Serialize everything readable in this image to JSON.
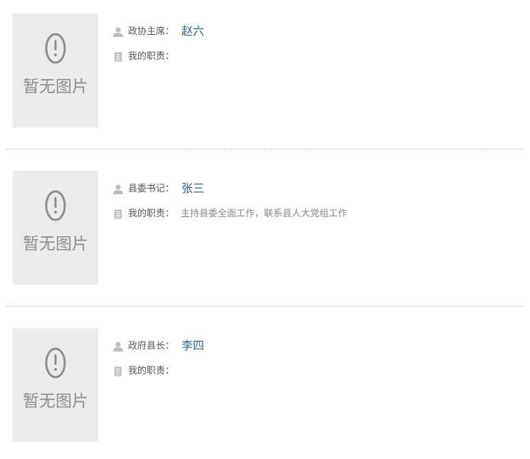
{
  "leaders": [
    {
      "photo_placeholder": "暂无图片",
      "title_label": "政协主席：",
      "name": "赵六",
      "duty_label": "我的职责：",
      "duty": ""
    },
    {
      "photo_placeholder": "暂无图片",
      "title_label": "县委书记：",
      "name": "张三",
      "duty_label": "我的职责：",
      "duty": "主持县委全面工作，联系县人大党组工作"
    },
    {
      "photo_placeholder": "暂无图片",
      "title_label": "政府县长：",
      "name": "李四",
      "duty_label": "我的职责：",
      "duty": ""
    }
  ],
  "icons": {
    "person": "user-icon",
    "duty": "document-icon",
    "placeholder": "exclamation-circle-icon"
  },
  "colors": {
    "name_link": "#2a6496",
    "photo_bg": "#ececec",
    "placeholder_gray": "#8e8e8e",
    "icon_gray": "#bdbdbd"
  }
}
